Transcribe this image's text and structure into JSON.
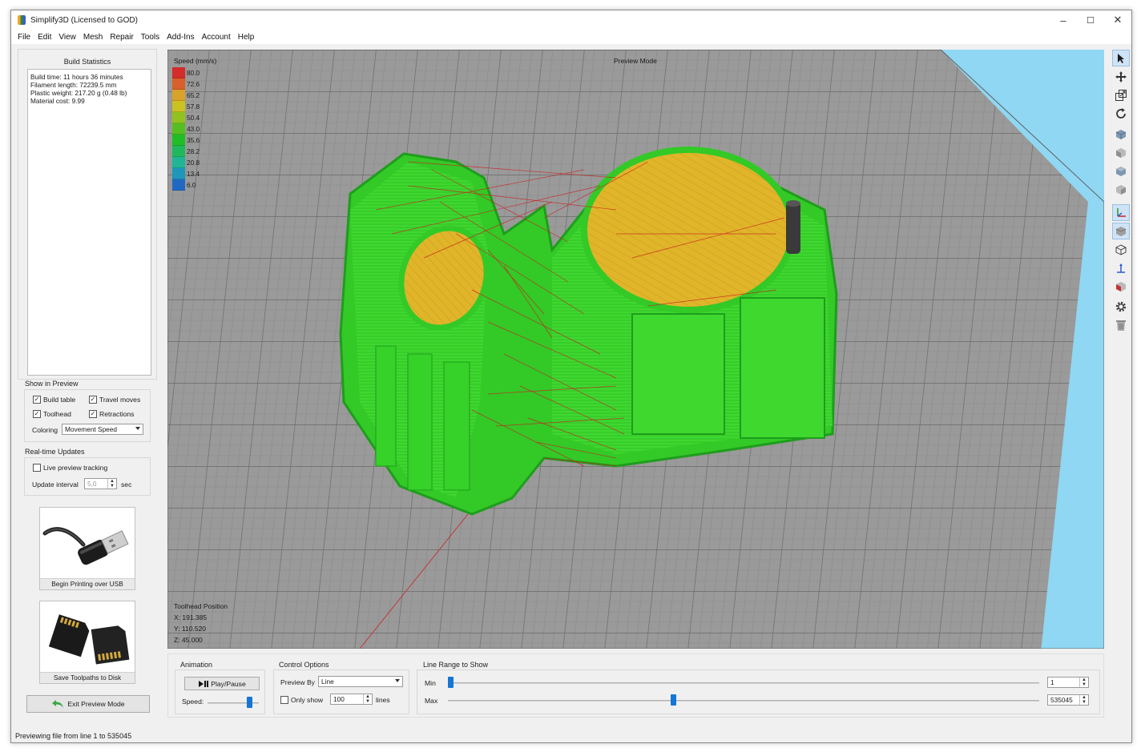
{
  "window": {
    "title": "Simplify3D (Licensed to GOD)",
    "minimize": "–",
    "maximize": "☐",
    "close": "✕"
  },
  "menu": [
    "File",
    "Edit",
    "View",
    "Mesh",
    "Repair",
    "Tools",
    "Add-Ins",
    "Account",
    "Help"
  ],
  "build_stats": {
    "title": "Build Statistics",
    "lines": [
      "Build time: 11 hours 36 minutes",
      "Filament length: 72239.5 mm",
      "Plastic weight: 217.20 g (0.48 lb)",
      "Material cost: 9.99"
    ]
  },
  "show_in_preview": {
    "title": "Show in Preview",
    "build_table": {
      "label": "Build table",
      "checked": true
    },
    "travel_moves": {
      "label": "Travel moves",
      "checked": true
    },
    "toolhead": {
      "label": "Toolhead",
      "checked": true
    },
    "retractions": {
      "label": "Retractions",
      "checked": true
    },
    "coloring_label": "Coloring",
    "coloring_value": "Movement Speed"
  },
  "realtime": {
    "title": "Real-time Updates",
    "live_tracking": {
      "label": "Live preview tracking",
      "checked": false
    },
    "interval_label": "Update interval",
    "interval_value": "5,0",
    "interval_unit": "sec"
  },
  "usb_button": "Begin Printing over USB",
  "sd_button": "Save Toolpaths to Disk",
  "exit_button": "Exit Preview Mode",
  "viewport": {
    "mode_label": "Preview Mode",
    "legend_title": "Speed (mm/s)",
    "legend": [
      {
        "value": "80.0",
        "color": "#d42b2b"
      },
      {
        "value": "72.6",
        "color": "#d8602a"
      },
      {
        "value": "65.2",
        "color": "#d9a329"
      },
      {
        "value": "57.8",
        "color": "#c9c221"
      },
      {
        "value": "50.4",
        "color": "#92c21f"
      },
      {
        "value": "43.0",
        "color": "#55bf22"
      },
      {
        "value": "35.6",
        "color": "#21bd27"
      },
      {
        "value": "28.2",
        "color": "#1fb95b"
      },
      {
        "value": "20.8",
        "color": "#1fb596"
      },
      {
        "value": "13.4",
        "color": "#1e97ba"
      },
      {
        "value": "6.0",
        "color": "#2168c2"
      }
    ],
    "toolhead": {
      "title": "Toolhead Position",
      "x": "X: 191.385",
      "y": "Y: 110.520",
      "z": "Z: 45.000"
    }
  },
  "animation": {
    "title": "Animation",
    "play_label": "Play/Pause",
    "speed_label": "Speed:",
    "speed_level": 0.85
  },
  "control_options": {
    "title": "Control Options",
    "preview_by_label": "Preview By",
    "preview_by_value": "Line",
    "only_show_label": "Only show",
    "only_show_checked": false,
    "only_show_value": "100",
    "only_show_unit": "lines"
  },
  "line_range": {
    "title": "Line Range to Show",
    "min_label": "Min",
    "max_label": "Max",
    "min_value": "1",
    "max_value": "535045",
    "min_fraction": 0.0,
    "max_fraction": 0.38
  },
  "status": "Previewing file from line 1 to 535045",
  "toolbar_icons": [
    "select-icon",
    "move-icon",
    "scale-icon",
    "rotate-icon",
    "view-iso-icon",
    "view-front-icon",
    "view-top-icon",
    "view-side-icon",
    "axes-icon",
    "solid-view-icon",
    "wireframe-icon",
    "normals-icon",
    "cross-section-icon",
    "settings-icon",
    "trash-icon"
  ]
}
